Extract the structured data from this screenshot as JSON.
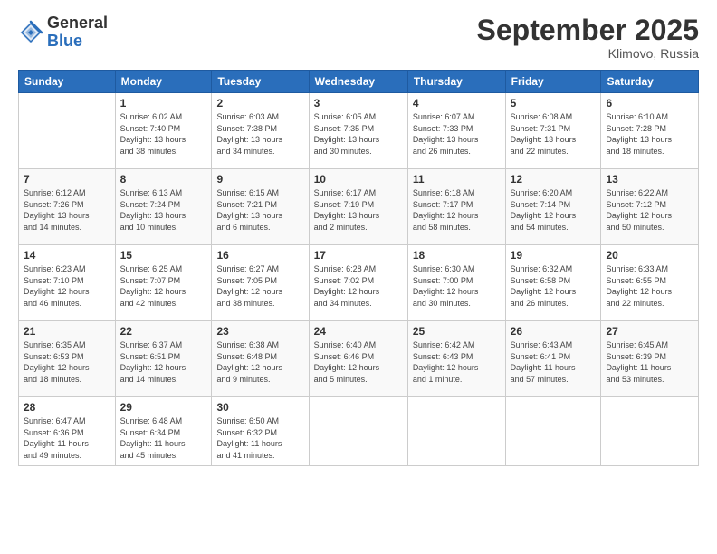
{
  "header": {
    "logo_general": "General",
    "logo_blue": "Blue",
    "month_title": "September 2025",
    "location": "Klimovo, Russia"
  },
  "days_of_week": [
    "Sunday",
    "Monday",
    "Tuesday",
    "Wednesday",
    "Thursday",
    "Friday",
    "Saturday"
  ],
  "weeks": [
    [
      {
        "day": "",
        "info": ""
      },
      {
        "day": "1",
        "info": "Sunrise: 6:02 AM\nSunset: 7:40 PM\nDaylight: 13 hours\nand 38 minutes."
      },
      {
        "day": "2",
        "info": "Sunrise: 6:03 AM\nSunset: 7:38 PM\nDaylight: 13 hours\nand 34 minutes."
      },
      {
        "day": "3",
        "info": "Sunrise: 6:05 AM\nSunset: 7:35 PM\nDaylight: 13 hours\nand 30 minutes."
      },
      {
        "day": "4",
        "info": "Sunrise: 6:07 AM\nSunset: 7:33 PM\nDaylight: 13 hours\nand 26 minutes."
      },
      {
        "day": "5",
        "info": "Sunrise: 6:08 AM\nSunset: 7:31 PM\nDaylight: 13 hours\nand 22 minutes."
      },
      {
        "day": "6",
        "info": "Sunrise: 6:10 AM\nSunset: 7:28 PM\nDaylight: 13 hours\nand 18 minutes."
      }
    ],
    [
      {
        "day": "7",
        "info": "Sunrise: 6:12 AM\nSunset: 7:26 PM\nDaylight: 13 hours\nand 14 minutes."
      },
      {
        "day": "8",
        "info": "Sunrise: 6:13 AM\nSunset: 7:24 PM\nDaylight: 13 hours\nand 10 minutes."
      },
      {
        "day": "9",
        "info": "Sunrise: 6:15 AM\nSunset: 7:21 PM\nDaylight: 13 hours\nand 6 minutes."
      },
      {
        "day": "10",
        "info": "Sunrise: 6:17 AM\nSunset: 7:19 PM\nDaylight: 13 hours\nand 2 minutes."
      },
      {
        "day": "11",
        "info": "Sunrise: 6:18 AM\nSunset: 7:17 PM\nDaylight: 12 hours\nand 58 minutes."
      },
      {
        "day": "12",
        "info": "Sunrise: 6:20 AM\nSunset: 7:14 PM\nDaylight: 12 hours\nand 54 minutes."
      },
      {
        "day": "13",
        "info": "Sunrise: 6:22 AM\nSunset: 7:12 PM\nDaylight: 12 hours\nand 50 minutes."
      }
    ],
    [
      {
        "day": "14",
        "info": "Sunrise: 6:23 AM\nSunset: 7:10 PM\nDaylight: 12 hours\nand 46 minutes."
      },
      {
        "day": "15",
        "info": "Sunrise: 6:25 AM\nSunset: 7:07 PM\nDaylight: 12 hours\nand 42 minutes."
      },
      {
        "day": "16",
        "info": "Sunrise: 6:27 AM\nSunset: 7:05 PM\nDaylight: 12 hours\nand 38 minutes."
      },
      {
        "day": "17",
        "info": "Sunrise: 6:28 AM\nSunset: 7:02 PM\nDaylight: 12 hours\nand 34 minutes."
      },
      {
        "day": "18",
        "info": "Sunrise: 6:30 AM\nSunset: 7:00 PM\nDaylight: 12 hours\nand 30 minutes."
      },
      {
        "day": "19",
        "info": "Sunrise: 6:32 AM\nSunset: 6:58 PM\nDaylight: 12 hours\nand 26 minutes."
      },
      {
        "day": "20",
        "info": "Sunrise: 6:33 AM\nSunset: 6:55 PM\nDaylight: 12 hours\nand 22 minutes."
      }
    ],
    [
      {
        "day": "21",
        "info": "Sunrise: 6:35 AM\nSunset: 6:53 PM\nDaylight: 12 hours\nand 18 minutes."
      },
      {
        "day": "22",
        "info": "Sunrise: 6:37 AM\nSunset: 6:51 PM\nDaylight: 12 hours\nand 14 minutes."
      },
      {
        "day": "23",
        "info": "Sunrise: 6:38 AM\nSunset: 6:48 PM\nDaylight: 12 hours\nand 9 minutes."
      },
      {
        "day": "24",
        "info": "Sunrise: 6:40 AM\nSunset: 6:46 PM\nDaylight: 12 hours\nand 5 minutes."
      },
      {
        "day": "25",
        "info": "Sunrise: 6:42 AM\nSunset: 6:43 PM\nDaylight: 12 hours\nand 1 minute."
      },
      {
        "day": "26",
        "info": "Sunrise: 6:43 AM\nSunset: 6:41 PM\nDaylight: 11 hours\nand 57 minutes."
      },
      {
        "day": "27",
        "info": "Sunrise: 6:45 AM\nSunset: 6:39 PM\nDaylight: 11 hours\nand 53 minutes."
      }
    ],
    [
      {
        "day": "28",
        "info": "Sunrise: 6:47 AM\nSunset: 6:36 PM\nDaylight: 11 hours\nand 49 minutes."
      },
      {
        "day": "29",
        "info": "Sunrise: 6:48 AM\nSunset: 6:34 PM\nDaylight: 11 hours\nand 45 minutes."
      },
      {
        "day": "30",
        "info": "Sunrise: 6:50 AM\nSunset: 6:32 PM\nDaylight: 11 hours\nand 41 minutes."
      },
      {
        "day": "",
        "info": ""
      },
      {
        "day": "",
        "info": ""
      },
      {
        "day": "",
        "info": ""
      },
      {
        "day": "",
        "info": ""
      }
    ]
  ]
}
